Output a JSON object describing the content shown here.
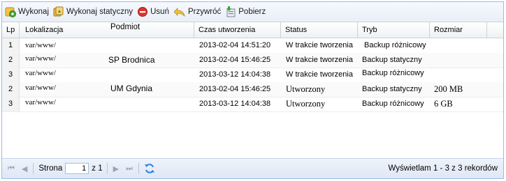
{
  "toolbar": {
    "execute_label": "Wykonaj",
    "execute_static_label": "Wykonaj statyczny",
    "delete_label": "Usuń",
    "restore_label": "Przywróć",
    "download_label": "Pobierz"
  },
  "grid": {
    "columns": {
      "lp": "Lp",
      "location": "Lokalizacja",
      "entity": "Podmiot",
      "created": "Czas utworzenia",
      "status": "Status",
      "mode": "Tryb",
      "size": "Rozmiar"
    },
    "rows": [
      {
        "lp": "1",
        "location": "var/www/",
        "entity": "",
        "created": "2013-02-04 14:51:20",
        "status": "W trakcie tworzenia",
        "mode": "Backup różnicowy",
        "size": ""
      },
      {
        "lp": "2",
        "location": "var/www/",
        "entity": "SP Brodnica",
        "created": "2013-02-04 15:46:25",
        "status": "W trakcie tworzenia",
        "mode": "Backup statyczny",
        "size": ""
      },
      {
        "lp": "3",
        "location": "var/www/",
        "entity": "",
        "created": "2013-03-12 14:04:38",
        "status": "W trakcie tworzenia",
        "mode": "Backup różnicowy",
        "size": ""
      },
      {
        "lp": "2",
        "location": "var/www/",
        "entity": "UM Gdynia",
        "created": "2013-02-04 15:46:25",
        "status": "Utworzony",
        "mode": "Backup statyczny",
        "size": "200 MB"
      },
      {
        "lp": "3",
        "location": "var/www/",
        "entity": "",
        "created": "2013-03-12 14:04:38",
        "status": "Utworzony",
        "mode": "Backup różnicowy",
        "size": "6 GB"
      }
    ]
  },
  "pager": {
    "page_label": "Strona",
    "page_value": "1",
    "of_label": "z 1",
    "display_info": "Wyświetlam 1 - 3 z 3 rekordów"
  }
}
